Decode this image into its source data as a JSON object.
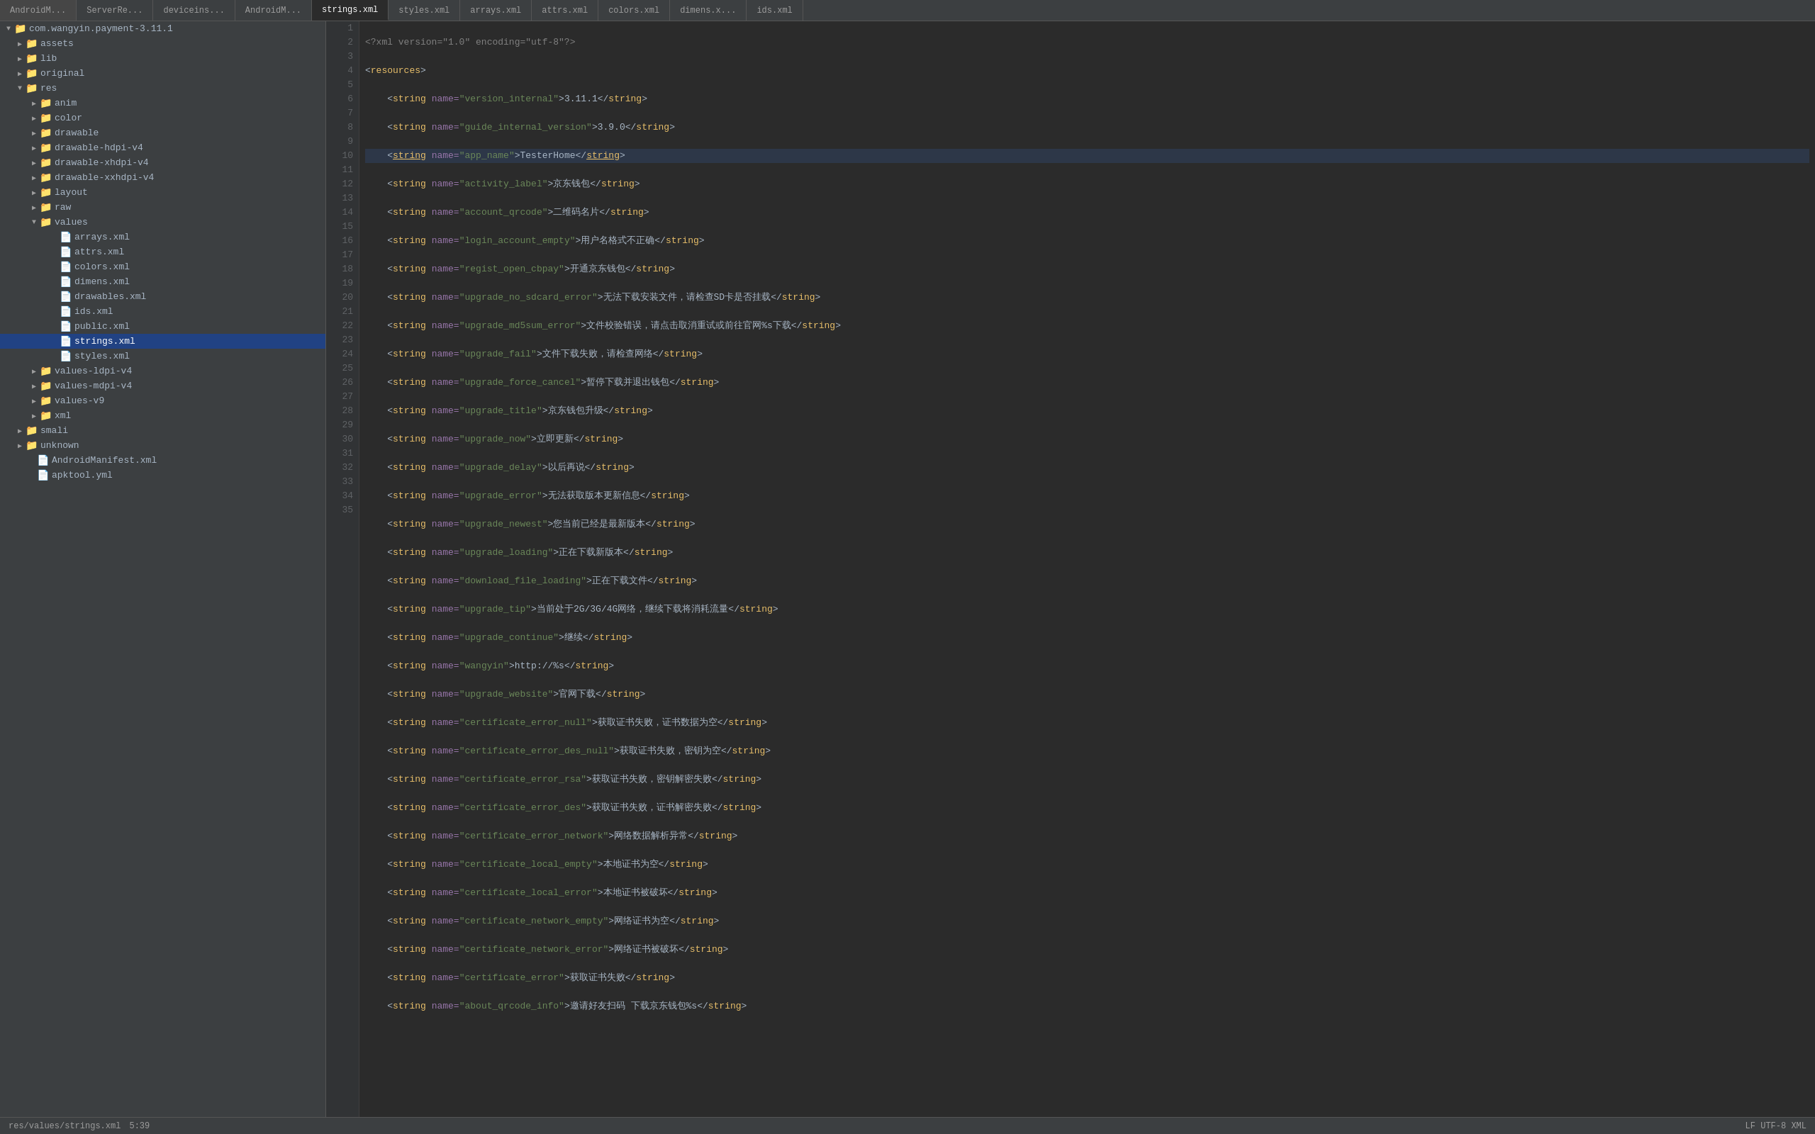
{
  "tabs": [
    {
      "label": "AndroidM...",
      "active": false
    },
    {
      "label": "ServerRe...",
      "active": false
    },
    {
      "label": "deviceins...",
      "active": false
    },
    {
      "label": "AndroidM...",
      "active": false
    },
    {
      "label": "strings.xml",
      "active": true
    },
    {
      "label": "styles.xml",
      "active": false
    },
    {
      "label": "arrays.xml",
      "active": false
    },
    {
      "label": "attrs.xml",
      "active": false
    },
    {
      "label": "colors.xml",
      "active": false
    },
    {
      "label": "dimens.x...",
      "active": false
    },
    {
      "label": "ids.xml",
      "active": false
    }
  ],
  "tree": {
    "root": "com.wangyin.payment-3.11.1"
  },
  "status": {
    "path": "res/values/strings.xml",
    "cursor": "5:39",
    "encoding": "LF   UTF-8   XML"
  },
  "lines": [
    "<?xml version=\"1.0\" encoding=\"utf-8\"?>",
    "<resources>",
    "    <string name=\"version_internal\">3.11.1</string>",
    "    <string name=\"guide_internal_version\">3.9.0</string>",
    "    <string name=\"app_name\">TesterHome</string>",
    "    <string name=\"activity_label\">京东钱包</string>",
    "    <string name=\"account_qrcode\">二维码名片</string>",
    "    <string name=\"login_account_empty\">用户名格式不正确</string>",
    "    <string name=\"regist_open_cbpay\">开通京东钱包</string>",
    "    <string name=\"upgrade_no_sdcard_error\">无法下载安装文件，请检查SD卡是否挂载</string>",
    "    <string name=\"upgrade_md5sum_error\">文件校验错误，请点击取消重试或前往官网%s下载</string>",
    "    <string name=\"upgrade_fail\">文件下载失败，请检查网络</string>",
    "    <string name=\"upgrade_force_cancel\">暂停下载并退出钱包</string>",
    "    <string name=\"upgrade_title\">京东钱包升级</string>",
    "    <string name=\"upgrade_now\">立即更新</string>",
    "    <string name=\"upgrade_delay\">以后再说</string>",
    "    <string name=\"upgrade_error\">无法获取版本更新信息</string>",
    "    <string name=\"upgrade_newest\">您当前已经是最新版本</string>",
    "    <string name=\"upgrade_loading\">正在下载新版本</string>",
    "    <string name=\"download_file_loading\">正在下载文件</string>",
    "    <string name=\"upgrade_tip\">当前处于2G/3G/4G网络，继续下载将消耗流量</string>",
    "    <string name=\"upgrade_continue\">继续</string>",
    "    <string name=\"wangyin\">http://%s</string>",
    "    <string name=\"upgrade_website\">官网下载</string>",
    "    <string name=\"certificate_error_null\">获取证书失败，证书数据为空</string>",
    "    <string name=\"certificate_error_des_null\">获取证书失败，密钥为空</string>",
    "    <string name=\"certificate_error_rsa\">获取证书失败，密钥解密失败</string>",
    "    <string name=\"certificate_error_des\">获取证书失败，证书解密失败</string>",
    "    <string name=\"certificate_error_network\">网络数据解析异常</string>",
    "    <string name=\"certificate_local_empty\">本地证书为空</string>",
    "    <string name=\"certificate_local_error\">本地证书被破坏</string>",
    "    <string name=\"certificate_network_empty\">网络证书为空</string>",
    "    <string name=\"certificate_network_error\">网络证书被破坏</string>",
    "    <string name=\"certificate_error\">获取证书失败</string>",
    "    <string name=\"about_qrcode_info\">邀请好友扫码 下载京东钱包%s</string>"
  ]
}
